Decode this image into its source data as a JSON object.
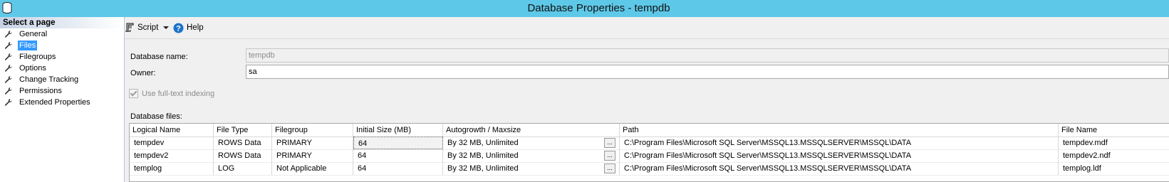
{
  "window": {
    "title": "Database Properties - tempdb"
  },
  "left_pane": {
    "header": "Select a page",
    "items": [
      {
        "label": "General"
      },
      {
        "label": "Files"
      },
      {
        "label": "Filegroups"
      },
      {
        "label": "Options"
      },
      {
        "label": "Change Tracking"
      },
      {
        "label": "Permissions"
      },
      {
        "label": "Extended Properties"
      }
    ],
    "selected": "Files"
  },
  "toolbar": {
    "script_label": "Script",
    "help_label": "Help"
  },
  "form": {
    "database_name_label": "Database name:",
    "database_name_value": "tempdb",
    "owner_label": "Owner:",
    "owner_value": "sa",
    "fulltext_label": "Use full-text indexing",
    "fulltext_checked": true,
    "database_files_label": "Database files:"
  },
  "grid": {
    "columns": [
      "Logical Name",
      "File Type",
      "Filegroup",
      "Initial Size (MB)",
      "Autogrowth / Maxsize",
      "Path",
      "File Name"
    ],
    "rows": [
      [
        "tempdev",
        "ROWS Data",
        "PRIMARY",
        "64",
        "By 32 MB, Unlimited",
        "C:\\Program Files\\Microsoft SQL Server\\MSSQL13.MSSQLSERVER\\MSSQL\\DATA",
        "tempdev.mdf"
      ],
      [
        "tempdev2",
        "ROWS Data",
        "PRIMARY",
        "64",
        "By 32 MB, Unlimited",
        "C:\\Program Files\\Microsoft SQL Server\\MSSQL13.MSSQLSERVER\\MSSQL\\DATA",
        "tempdev2.ndf"
      ],
      [
        "templog",
        "LOG",
        "Not Applicable",
        "64",
        "By 32 MB, Unlimited",
        "C:\\Program Files\\Microsoft SQL Server\\MSSQL13.MSSQLSERVER\\MSSQL\\DATA",
        "templog.ldf"
      ]
    ],
    "ellipsis_label": "..."
  },
  "colors": {
    "titlebar": "#5ec8e8",
    "selection": "#3399ff",
    "help_icon": "#1e73c8"
  }
}
